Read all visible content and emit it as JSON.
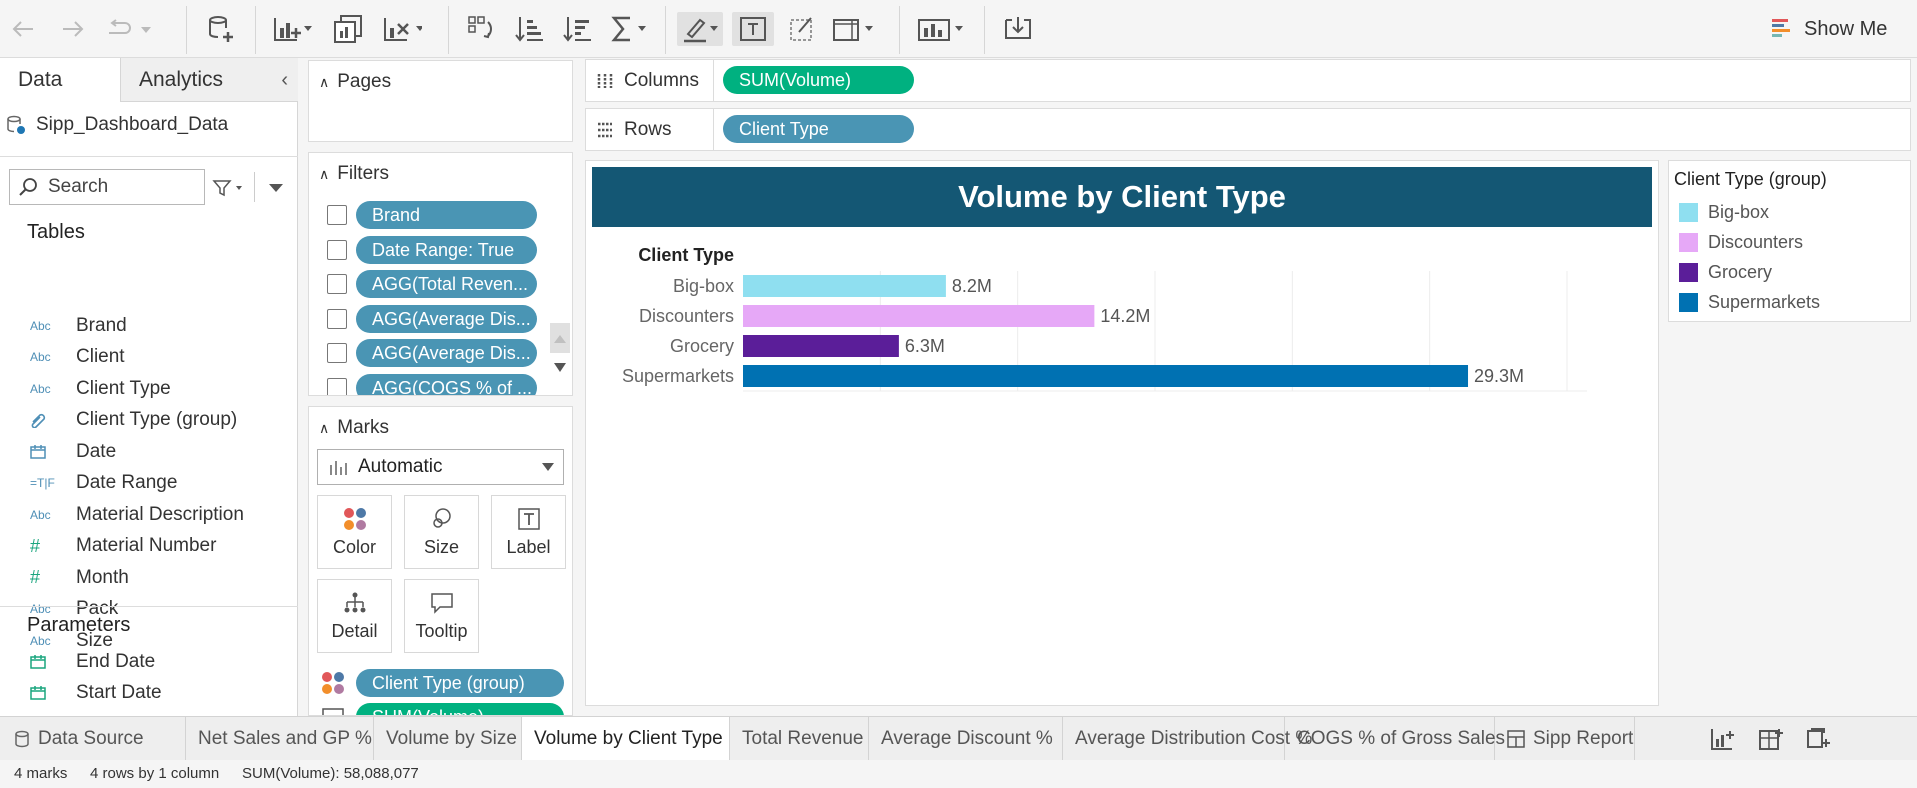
{
  "toolbar": {
    "show_me_label": "Show Me"
  },
  "data_pane": {
    "tabs": [
      "Data",
      "Analytics"
    ],
    "datasource": "Sipp_Dashboard_Data",
    "search_placeholder": "Search",
    "tables_heading": "Tables",
    "fields": [
      {
        "type": "Abc",
        "name": "Brand"
      },
      {
        "type": "Abc",
        "name": "Client"
      },
      {
        "type": "Abc",
        "name": "Client Type"
      },
      {
        "type": "clip",
        "name": "Client Type (group)"
      },
      {
        "type": "cal",
        "name": "Date"
      },
      {
        "type": "=T|F",
        "name": "Date Range"
      },
      {
        "type": "Abc",
        "name": "Material Description"
      },
      {
        "type": "#",
        "name": "Material Number"
      },
      {
        "type": "#",
        "name": "Month"
      },
      {
        "type": "Abc",
        "name": "Pack"
      },
      {
        "type": "Abc",
        "name": "Size"
      }
    ],
    "parameters_heading": "Parameters",
    "parameters": [
      "End Date",
      "Start Date"
    ]
  },
  "cards": {
    "pages_title": "Pages",
    "filters_title": "Filters",
    "filters": [
      "Brand",
      "Date Range: True",
      "AGG(Total Reven...",
      "AGG(Average Dis...",
      "AGG(Average Dis...",
      "AGG(COGS % of ..."
    ],
    "marks_title": "Marks",
    "mark_type": "Automatic",
    "mark_buttons": [
      "Color",
      "Size",
      "Label",
      "Detail",
      "Tooltip"
    ],
    "mark_pills": [
      "Client Type (group)",
      "SUM(Volume)"
    ]
  },
  "shelves": {
    "columns_label": "Columns",
    "columns_pill": "SUM(Volume)",
    "rows_label": "Rows",
    "rows_pill": "Client Type"
  },
  "chart_data": {
    "type": "bar",
    "title": "Volume by Client Type",
    "row_header": "Client Type",
    "categories": [
      "Big-box",
      "Discounters",
      "Grocery",
      "Supermarkets"
    ],
    "values": [
      8.2,
      14.2,
      6.3,
      29.3
    ],
    "value_labels": [
      "8.2M",
      "14.2M",
      "6.3M",
      "29.3M"
    ],
    "colors": [
      "#8fdff0",
      "#e6a8f7",
      "#5b1e99",
      "#0071b2"
    ],
    "xlim": [
      0,
      33.3
    ]
  },
  "legend": {
    "title": "Client Type (group)",
    "items": [
      {
        "label": "Big-box",
        "color": "#8fdff0"
      },
      {
        "label": "Discounters",
        "color": "#e6a8f7"
      },
      {
        "label": "Grocery",
        "color": "#5b1e99"
      },
      {
        "label": "Supermarkets",
        "color": "#0071b2"
      }
    ]
  },
  "sheet_tabs": {
    "data_source": "Data Source",
    "sheets": [
      "Net Sales and GP %",
      "Volume by Size",
      "Volume by Client Type",
      "Total Revenue",
      "Average Discount %",
      "Average Distribution Cost %",
      "COGS % of Gross Sales",
      "Sipp Report"
    ],
    "active": "Volume by Client Type"
  },
  "status": {
    "marks": "4 marks",
    "dims": "4 rows by 1 column",
    "sum": "SUM(Volume): 58,088,077"
  }
}
